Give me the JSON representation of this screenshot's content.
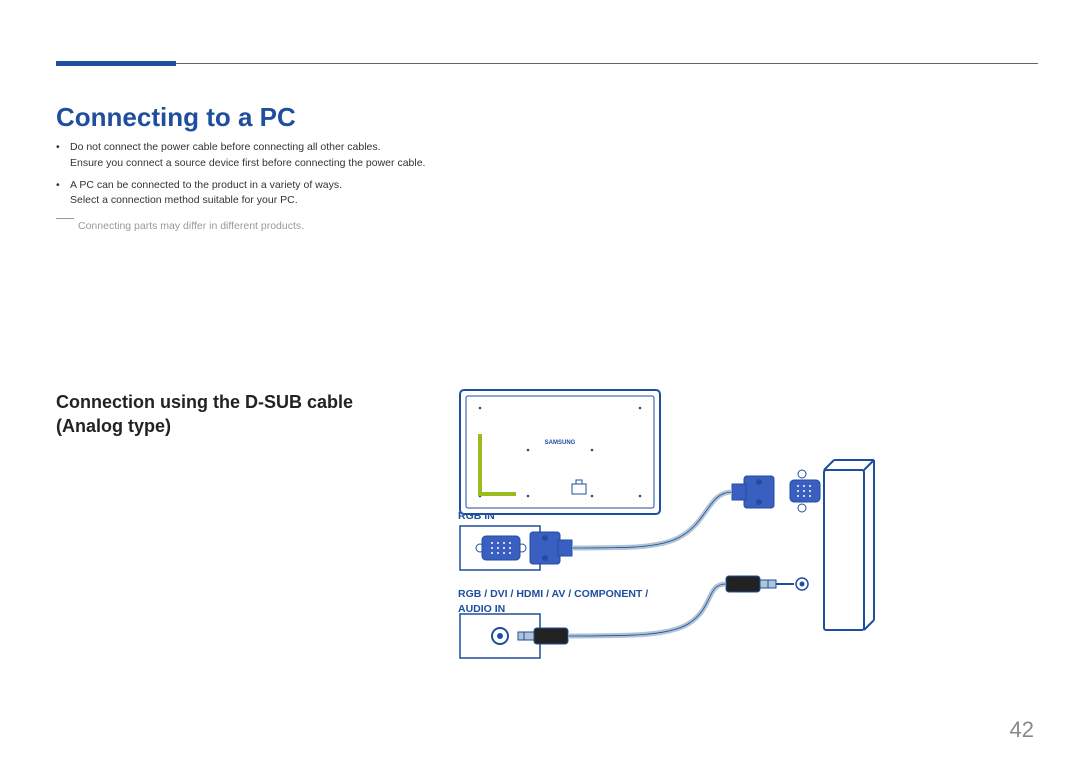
{
  "section_title": "Connecting to a PC",
  "bullets": [
    "Do not connect the power cable before connecting all other cables.\nEnsure you connect a source device first before connecting the power cable.",
    "A PC can be connected to the product in a variety of ways.\nSelect a connection method suitable for your PC."
  ],
  "footnote": "Connecting parts may differ in different products.",
  "subsection_title": "Connection using the D-SUB cable (Analog type)",
  "samsung_label": "SAMSUNG",
  "labels": {
    "rgb_in": "RGB IN",
    "audio_in": "RGB / DVI / HDMI / AV / COMPONENT / AUDIO IN"
  },
  "page_number": "42"
}
